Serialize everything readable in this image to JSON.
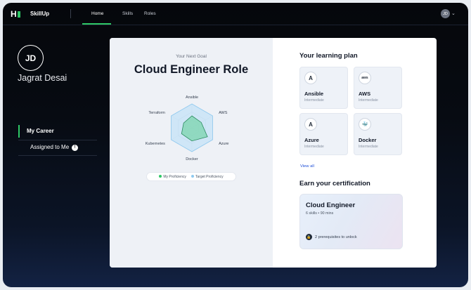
{
  "nav": {
    "logo": "H",
    "brand": "SkillUp",
    "links": [
      "Home",
      "Skills",
      "Roles"
    ],
    "avatar_initials": "JD",
    "accent": "#2ec866"
  },
  "sidebar": {
    "avatar_initials": "JD",
    "user_name": "Jagrat Desai",
    "items": [
      {
        "label": "My Career",
        "active": true
      },
      {
        "label": "Assigned to Me",
        "badge": "!"
      }
    ]
  },
  "goal": {
    "subtitle": "Your Next Goal",
    "title": "Cloud Engineer Role",
    "radar_axes": [
      "Ansible",
      "AWS",
      "Azure",
      "Docker",
      "Kubernetes",
      "Terraform"
    ],
    "my_proficiency": [
      0.5,
      0.45,
      0.75,
      0.55,
      0.5,
      0.4
    ],
    "target_proficiency": [
      1,
      1,
      1,
      1,
      1,
      1
    ],
    "legend": {
      "my": "My Proficiency",
      "target": "Target Proficiency"
    },
    "colors": {
      "my": "#2ec866",
      "target": "#8ec9ef"
    }
  },
  "plan": {
    "title": "Your learning plan",
    "skills": [
      {
        "name": "Ansible",
        "level": "Intermediate",
        "icon": "ansible-icon",
        "glyph": "A"
      },
      {
        "name": "AWS",
        "level": "Intermediate",
        "icon": "aws-icon",
        "glyph": "aws"
      },
      {
        "name": "Azure",
        "level": "Intermediate",
        "icon": "azure-icon",
        "glyph": "A"
      },
      {
        "name": "Docker",
        "level": "Intermediate",
        "icon": "docker-icon",
        "glyph": "🐳"
      }
    ],
    "view_all": "View all"
  },
  "certification": {
    "title": "Earn your certification",
    "card_title": "Cloud Engineer",
    "meta": "6 skills • 90 mins",
    "prereq": "2 prerequisites to unlock"
  }
}
